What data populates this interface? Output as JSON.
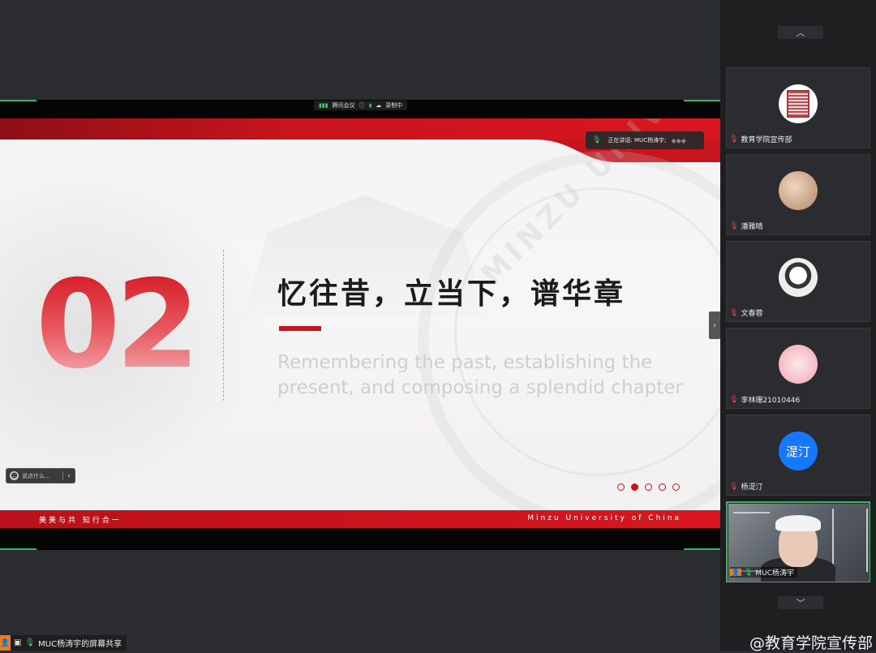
{
  "meeting": {
    "app_name": "腾讯会议",
    "recording_status": "录制中",
    "speaking_label": "正在讲话: MUC杨涛宇;",
    "share_label": "MUC杨涛宇的屏幕共享",
    "chat_placeholder": "说点什么..."
  },
  "slide": {
    "section_number": "02",
    "title_cn": "忆往昔，立当下，谱华章",
    "subtitle_en": "Remembering the past, establishing the present, and composing a splendid chapter",
    "footer_left": "美美与共  知行合一",
    "footer_right": "Minzu University of China",
    "seal_text": "MINZU UNIV",
    "university_en": "MINZU UNIVERSITY OF CHINA",
    "page_total": 5,
    "page_active": 2
  },
  "participants": [
    {
      "name": "教育学院宣传部",
      "avatar": "seal-avatar"
    },
    {
      "name": "潘雅晴",
      "avatar": "photo-avatar"
    },
    {
      "name": "文春蓉",
      "avatar": "cartoon-avatar"
    },
    {
      "name": "李林珊21010446",
      "avatar": "rabbit-avatar"
    },
    {
      "name": "杨湜汀",
      "avatar": "text-avatar",
      "avatar_text": "湜汀"
    }
  ],
  "active_video": {
    "name": "MUC杨涛宇"
  },
  "watermark": "@教育学院宣传部",
  "colors": {
    "accent_red": "#c8141d",
    "speaking_green": "#3ad16e",
    "avatar_blue": "#1677ff"
  },
  "icons": {
    "mic": "microphone-icon",
    "signal": "signal-icon",
    "info": "info-icon",
    "cloud": "cloud-record-icon",
    "chevron_up": "chevron-up-icon",
    "chevron_down": "chevron-down-icon",
    "chevron_left": "chevron-left-icon",
    "chevron_right": "chevron-right-icon",
    "emoji": "emoji-icon"
  }
}
